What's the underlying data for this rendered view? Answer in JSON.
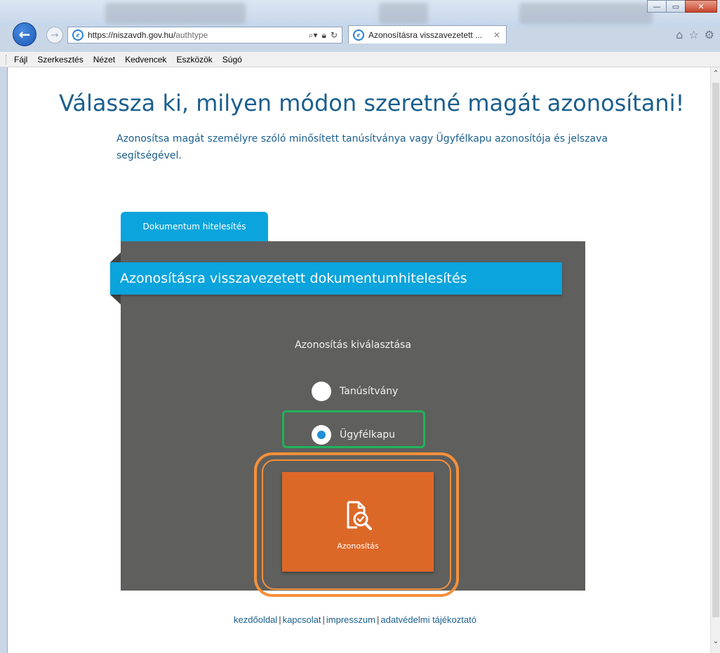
{
  "browser": {
    "url_host": "https://niszavdh.gov.hu/",
    "url_path": "authtype",
    "tab_title": "Azonosításra visszavezetett ...",
    "window_buttons": [
      "—",
      "▭",
      "✕"
    ]
  },
  "menu": {
    "items": [
      "Fájl",
      "Szerkesztés",
      "Nézet",
      "Kedvencek",
      "Eszközök",
      "Súgó"
    ]
  },
  "page": {
    "headline": "Válassza ki, milyen módon szeretné magát azonosítani!",
    "subtext": "Azonosítsa magát személyre szóló minősített tanúsítványa vagy Ügyfélkapu azonosítója és jelszava segítségével.",
    "tab_label": "Dokumentum hitelesítés",
    "ribbon_title": "Azonosításra visszavezetett dokumentumhitelesítés",
    "select_label": "Azonosítás kiválasztása",
    "options": [
      {
        "label": "Tanúsítvány",
        "selected": false
      },
      {
        "label": "Ügyfélkapu",
        "selected": true
      }
    ],
    "submit_label": "Azonosítás"
  },
  "footer": {
    "links": [
      "kezdőoldal",
      "kapcsolat",
      "impresszum",
      "adatvédelmi tájékoztató"
    ],
    "separator": "|"
  },
  "colors": {
    "accent_blue": "#0ba4dc",
    "panel_gray": "#5f5f5d",
    "button_orange": "#dc6828",
    "highlight_green": "#1fb35a",
    "highlight_orange": "#f5903a",
    "text_blue": "#1a5f8e"
  }
}
